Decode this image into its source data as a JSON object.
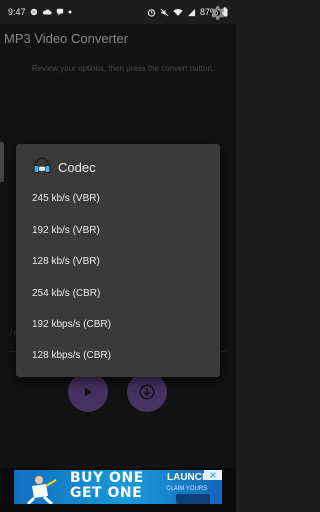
{
  "status_bar": {
    "time": "9:47",
    "battery_percent": "87%"
  },
  "app_bar": {
    "title": "MP3 Video Converter"
  },
  "instruction_text": "Review your options, then press the convert button.",
  "background_field_text": "/\no",
  "codec_dialog": {
    "title": "Codec",
    "options": [
      "245 kb/s (VBR)",
      "192  kb/s (VBR)",
      "128  kb/s (VBR)",
      "254 kb/s (CBR)",
      "192 kbps/s (CBR)",
      "128 kbps/s (CBR)"
    ]
  },
  "ad_banner": {
    "headline": "BUY ONE GET ONE",
    "right_title": "LAUNCH",
    "right_sub": "CLAIM YOURS"
  },
  "colors": {
    "background": "#1d1d1d",
    "dialog": "#3a3a3a",
    "fab": "#6b4f9a",
    "accent_icon": "#3ab5e6"
  },
  "icons": {
    "settings": "gear-icon",
    "play": "play-icon",
    "download": "download-icon",
    "codec": "headphones-icon"
  }
}
